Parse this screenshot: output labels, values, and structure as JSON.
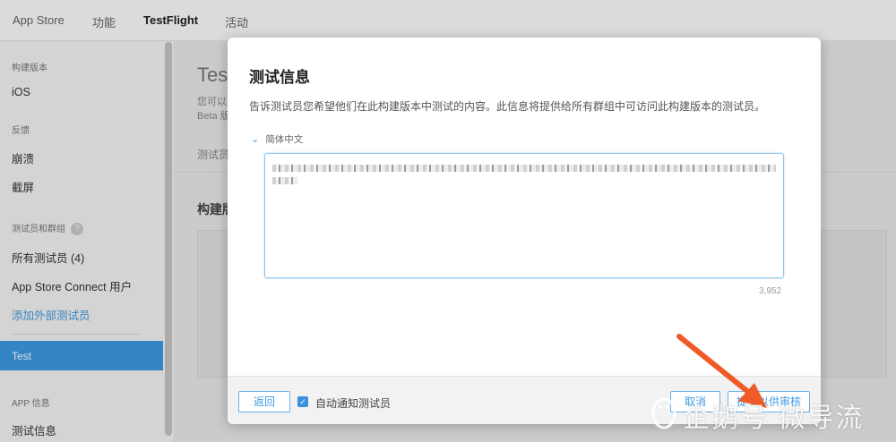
{
  "topnav": {
    "tabs": [
      {
        "label": "App Store",
        "active": false
      },
      {
        "label": "功能",
        "active": false
      },
      {
        "label": "TestFlight",
        "active": true
      },
      {
        "label": "活动",
        "active": false
      }
    ]
  },
  "sidebar": {
    "section_build": "构建版本",
    "item_ios": "iOS",
    "section_feedback": "反馈",
    "item_crashes": "崩溃",
    "item_screenshots": "截屏",
    "section_testers": "测试员和群组",
    "help_glyph": "?",
    "item_all_testers": "所有测试员 (4)",
    "item_asc_users": "App Store Connect 用户",
    "item_add_external": "添加外部测试员",
    "item_test_group": "Test",
    "section_app_info": "APP 信息",
    "item_test_info": "测试信息"
  },
  "background": {
    "heading_partial": "Test",
    "desc_partial_1": "您可以",
    "desc_partial_2": "Beta 版",
    "tab_partial": "测试员",
    "section_partial": "构建版"
  },
  "modal": {
    "title": "测试信息",
    "description": "告诉测试员您希望他们在此构建版本中测试的内容。此信息将提供给所有群组中可访问此构建版本的测试员。",
    "language_label": "简体中文",
    "char_remaining": "3,952",
    "back_button": "返回",
    "auto_notify_label": "自动通知测试员",
    "auto_notify_checked": true,
    "cancel_button": "取消",
    "submit_button": "提交以供审核"
  },
  "watermark": {
    "text": "企鹅号 微导流"
  },
  "colors": {
    "accent": "#3d9be6",
    "arrow": "#f05a28",
    "link": "#3f9ce0"
  }
}
